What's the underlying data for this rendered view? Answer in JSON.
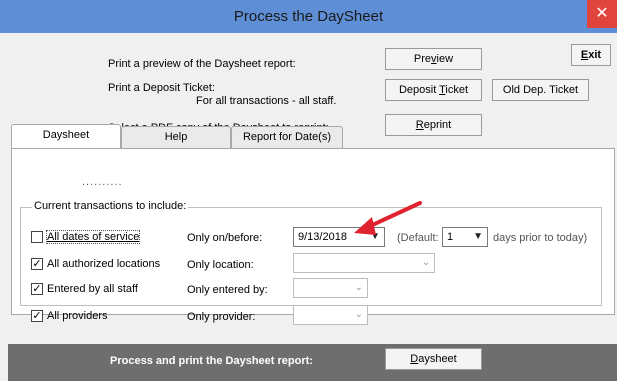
{
  "window": {
    "title": "Process the DaySheet",
    "close_glyph": "✕"
  },
  "top": {
    "preview_text": "Print a preview of the Daysheet report:",
    "deposit_text_1": "Print a Deposit Ticket:",
    "deposit_text_2": "For all transactions - all staff.",
    "reprint_text": "Select a PDF copy of the Daysheet to reprint:",
    "preview_btn": {
      "pre": "Pre",
      "u": "v",
      "post": "iew"
    },
    "exit_btn": {
      "pre": "",
      "u": "E",
      "post": "xit"
    },
    "deposit_btn": {
      "pre": "Deposit ",
      "u": "T",
      "post": "icket"
    },
    "old_dep_btn": "Old Dep. Ticket",
    "reprint_btn": {
      "pre": "",
      "u": "R",
      "post": "eprint"
    }
  },
  "tabs": [
    "Daysheet",
    "Help",
    "Report for Date(s)"
  ],
  "dots": "..........",
  "group": {
    "label": "Current transactions to include:",
    "rows": [
      {
        "check_label": "All dates of service",
        "checked": false,
        "field_label": "Only on/before:"
      },
      {
        "check_label": "All authorized locations",
        "checked": true,
        "field_label": "Only location:"
      },
      {
        "check_label": "Entered by all staff",
        "checked": true,
        "field_label": "Only entered by:"
      },
      {
        "check_label": "All providers",
        "checked": true,
        "field_label": "Only provider:"
      }
    ],
    "date_value": "9/13/2018",
    "default_label": "(Default:",
    "default_value": "1",
    "days_text": "days prior to today)"
  },
  "footer": {
    "text": "Process and print the Daysheet report:",
    "button": {
      "pre": "",
      "u": "D",
      "post": "aysheet"
    }
  },
  "colors": {
    "titlebar": "#5e8fd6",
    "close": "#e0443c",
    "annotation_arrow": "#e0232f"
  },
  "icons": {
    "check": "✓",
    "dropdown": "chevron-down-icon",
    "close": "close-icon",
    "arrow": "red-arrow-annotation"
  }
}
